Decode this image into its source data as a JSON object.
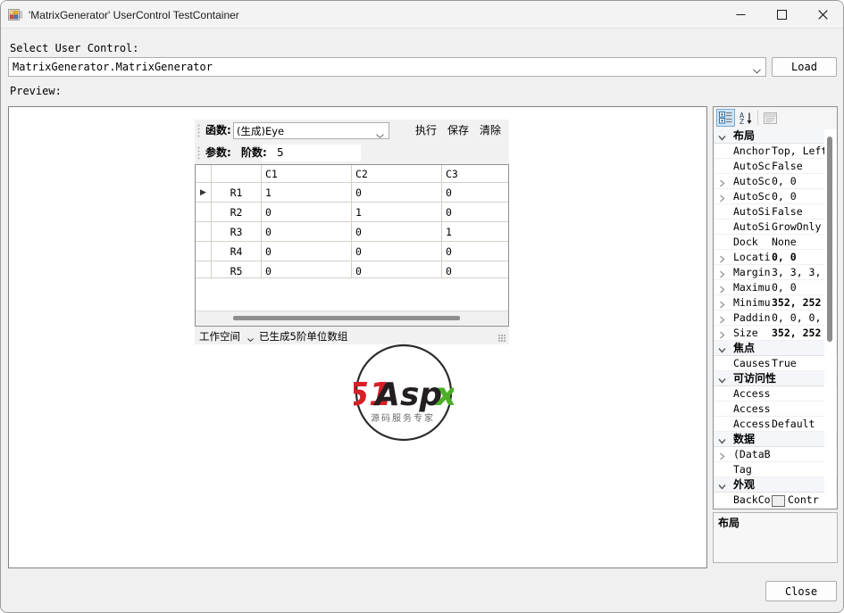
{
  "window": {
    "title": "'MatrixGenerator' UserControl TestContainer",
    "app_icon": "usercontrol-test-container-icon",
    "minimize_icon": "minimize-icon",
    "maximize_icon": "maximize-icon",
    "close_icon": "close-icon"
  },
  "form": {
    "select_label": "Select User Control:",
    "control_combo_value": "MatrixGenerator.MatrixGenerator",
    "load_button": "Load",
    "preview_label": "Preview:",
    "close_button": "Close"
  },
  "usercontrol": {
    "toolbar1": {
      "function_label": "函数:",
      "function_value": "(生成)Eye",
      "execute_button": "执行",
      "save_button": "保存",
      "clear_button": "清除"
    },
    "toolbar2": {
      "params_label": "参数:",
      "order_label": "阶数:",
      "order_value": "5"
    },
    "grid": {
      "columns": [
        "",
        "C1",
        "C2",
        "C3"
      ],
      "rows": [
        {
          "header": "R1",
          "cells": [
            "1",
            "0",
            "0"
          ],
          "current": true
        },
        {
          "header": "R2",
          "cells": [
            "0",
            "1",
            "0"
          ],
          "current": false
        },
        {
          "header": "R3",
          "cells": [
            "0",
            "0",
            "1"
          ],
          "current": false
        },
        {
          "header": "R4",
          "cells": [
            "0",
            "0",
            "0"
          ],
          "current": false
        },
        {
          "header": "R5",
          "cells": [
            "0",
            "0",
            "0"
          ],
          "current": false
        }
      ],
      "selected_cell": {
        "row": 0,
        "col": 0,
        "value": "1"
      },
      "row_marker_icon": "current-row-arrow-icon",
      "selection_color": "#0b74cf"
    },
    "statusbar": {
      "workspace_label": "工作空间",
      "dropdown_icon": "chevron-down-icon",
      "message": "已生成5阶单位数组"
    }
  },
  "watermark": {
    "text_51": "51",
    "text_aspx": "Aspx",
    "subtitle": "源码服务专家",
    "red": "#d81f26",
    "dark": "#231f20",
    "green": "#4caf27"
  },
  "propertygrid": {
    "toolbar": {
      "categorized_icon": "categorized-view-icon",
      "alphabetical_icon": "alphabetical-sort-icon",
      "property_pages_icon": "property-pages-icon"
    },
    "rows": [
      {
        "type": "category",
        "label": "布局",
        "expand": "collapse-chevron-icon"
      },
      {
        "type": "prop",
        "name": "Anchor",
        "value": "Top, Left",
        "expandable": false,
        "bold": false
      },
      {
        "type": "prop",
        "name": "AutoSc",
        "value": "False",
        "expandable": false,
        "bold": false
      },
      {
        "type": "prop",
        "name": "AutoSc",
        "value": "0, 0",
        "expandable": true,
        "bold": false
      },
      {
        "type": "prop",
        "name": "AutoSc",
        "value": "0, 0",
        "expandable": true,
        "bold": false
      },
      {
        "type": "prop",
        "name": "AutoSi",
        "value": "False",
        "expandable": false,
        "bold": false
      },
      {
        "type": "prop",
        "name": "AutoSi",
        "value": "GrowOnly",
        "expandable": false,
        "bold": false
      },
      {
        "type": "prop",
        "name": "Dock",
        "value": "None",
        "expandable": false,
        "bold": false
      },
      {
        "type": "prop",
        "name": "Locati",
        "value": "0, 0",
        "expandable": true,
        "bold": true
      },
      {
        "type": "prop",
        "name": "Margin",
        "value": "3, 3, 3,",
        "expandable": true,
        "bold": false
      },
      {
        "type": "prop",
        "name": "Maximu",
        "value": "0, 0",
        "expandable": true,
        "bold": false
      },
      {
        "type": "prop",
        "name": "Minimu",
        "value": "352, 252",
        "expandable": true,
        "bold": true
      },
      {
        "type": "prop",
        "name": "Paddin",
        "value": "0, 0, 0,",
        "expandable": true,
        "bold": false
      },
      {
        "type": "prop",
        "name": "Size",
        "value": "352, 252",
        "expandable": true,
        "bold": true
      },
      {
        "type": "category",
        "label": "焦点",
        "expand": "collapse-chevron-icon"
      },
      {
        "type": "prop",
        "name": "Causes",
        "value": "True",
        "expandable": false,
        "bold": false
      },
      {
        "type": "category",
        "label": "可访问性",
        "expand": "collapse-chevron-icon"
      },
      {
        "type": "prop",
        "name": "Access",
        "value": "",
        "expandable": false,
        "bold": false
      },
      {
        "type": "prop",
        "name": "Access",
        "value": "",
        "expandable": false,
        "bold": false
      },
      {
        "type": "prop",
        "name": "Access",
        "value": "Default",
        "expandable": false,
        "bold": false
      },
      {
        "type": "category",
        "label": "数据",
        "expand": "collapse-chevron-icon"
      },
      {
        "type": "prop",
        "name": "(DataB",
        "value": "",
        "expandable": true,
        "bold": false
      },
      {
        "type": "prop",
        "name": "Tag",
        "value": "",
        "expandable": false,
        "bold": false
      },
      {
        "type": "category",
        "label": "外观",
        "expand": "collapse-chevron-icon"
      },
      {
        "type": "color",
        "name": "BackCo",
        "value": "Contr",
        "swatch": "#f0f0f0",
        "expandable": false,
        "bold": false
      }
    ],
    "description": {
      "title": "布局"
    }
  }
}
